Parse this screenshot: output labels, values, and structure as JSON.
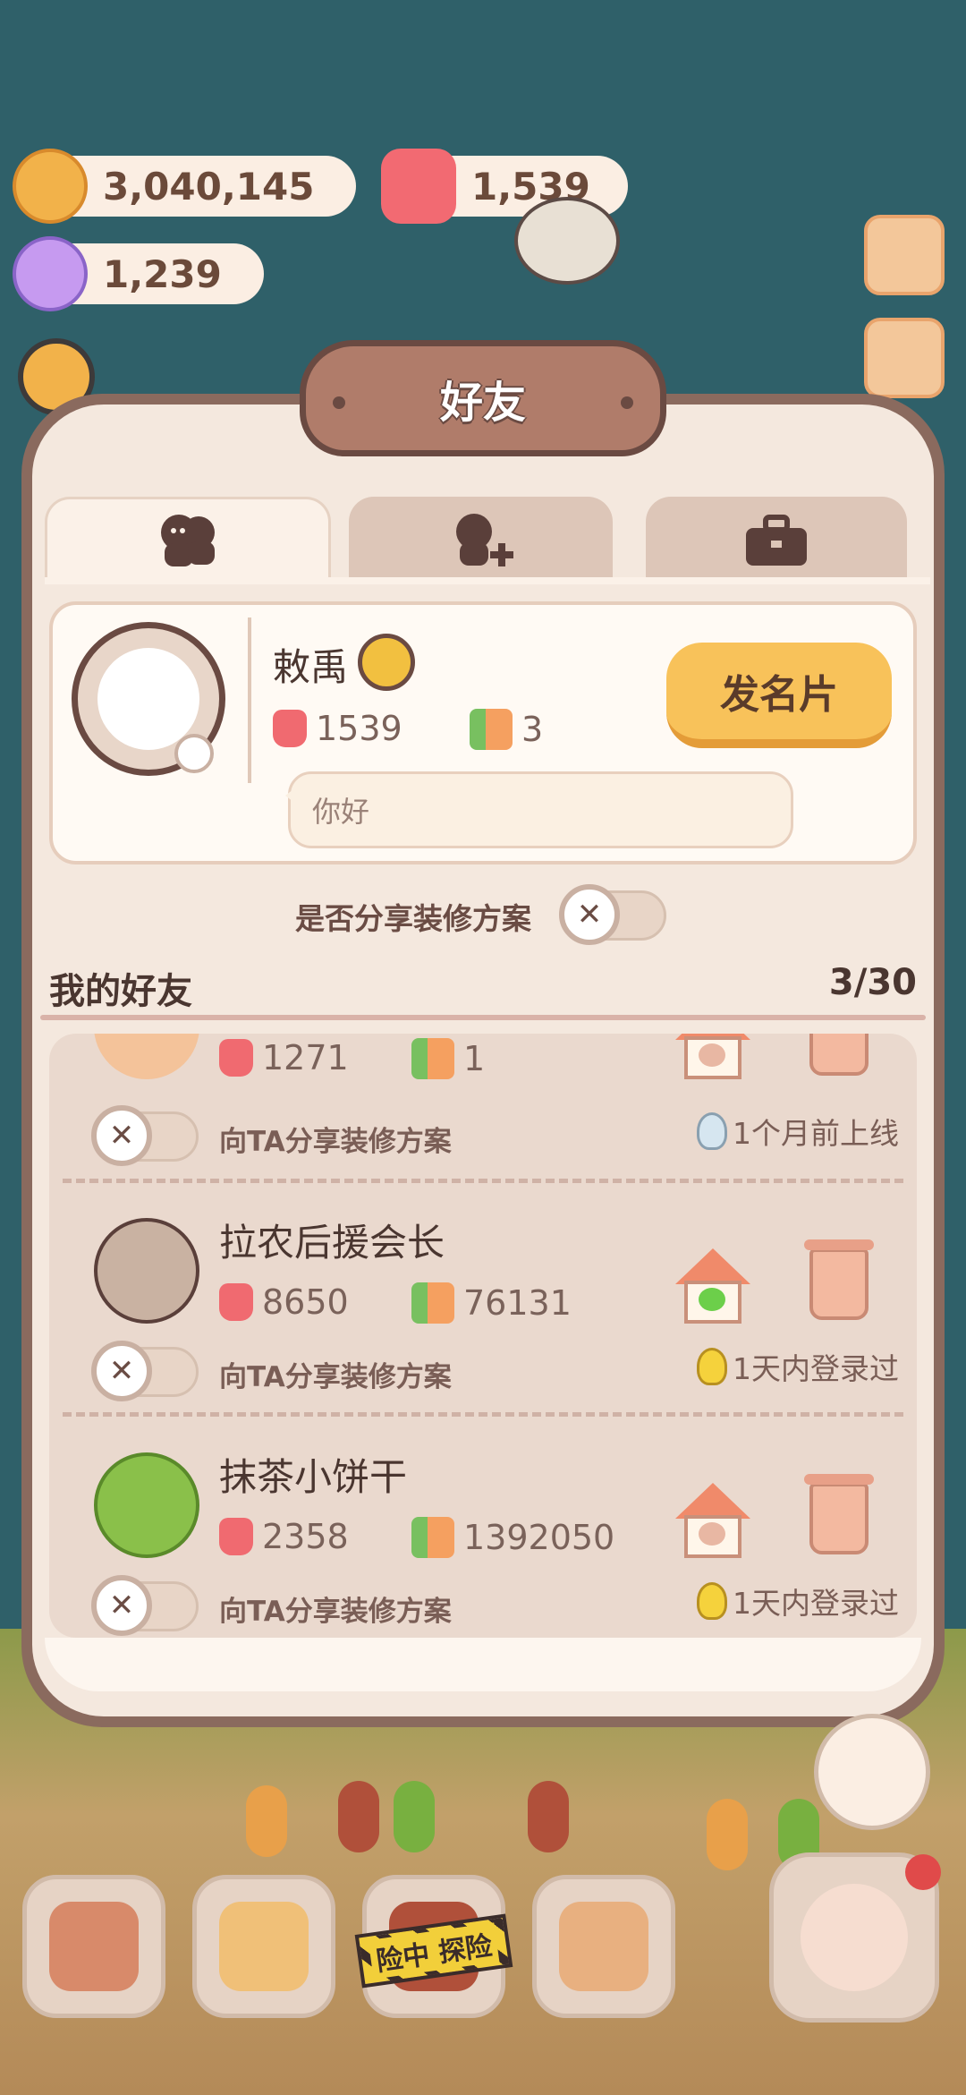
{
  "resources": {
    "coins": "3,040,145",
    "jelly": "1,539",
    "crystal": "1,239"
  },
  "panel": {
    "title": "好友",
    "tabs": [
      {
        "icon": "friends-icon"
      },
      {
        "icon": "add-friend-icon"
      },
      {
        "icon": "briefcase-icon"
      }
    ]
  },
  "profile": {
    "name": "敕禹",
    "jelly_count": "1539",
    "trophy_count": "3",
    "send_card_label": "发名片",
    "greeting": "你好"
  },
  "share_setting": {
    "label": "是否分享装修方案",
    "knob": "✕"
  },
  "friends": {
    "title": "我的好友",
    "count": "3/30",
    "list": [
      {
        "name": "",
        "jelly": "1271",
        "trophy": "1",
        "share_label": "向TA分享装修方案",
        "online": "1个月前上线",
        "heart_color": "#e8b7a3",
        "bulb_color": "#d6e6f0"
      },
      {
        "name": "拉农后援会长",
        "jelly": "8650",
        "trophy": "76131",
        "share_label": "向TA分享装修方案",
        "online": "1天内登录过",
        "heart_color": "#6ccf4a",
        "bulb_color": "#f5d23c"
      },
      {
        "name": "抹茶小饼干",
        "jelly": "2358",
        "trophy": "1392050",
        "share_label": "向TA分享装修方案",
        "online": "1天内登录过",
        "heart_color": "#e8b7a3",
        "bulb_color": "#f5d23c"
      }
    ]
  },
  "bottom_nav": {
    "adventure_tape": "险中 探险"
  },
  "colors": {
    "panel_border": "#8a6a5e",
    "panel_bg": "#f4e8de",
    "button_yellow": "#f8c25a",
    "sky": "#2f6069"
  }
}
